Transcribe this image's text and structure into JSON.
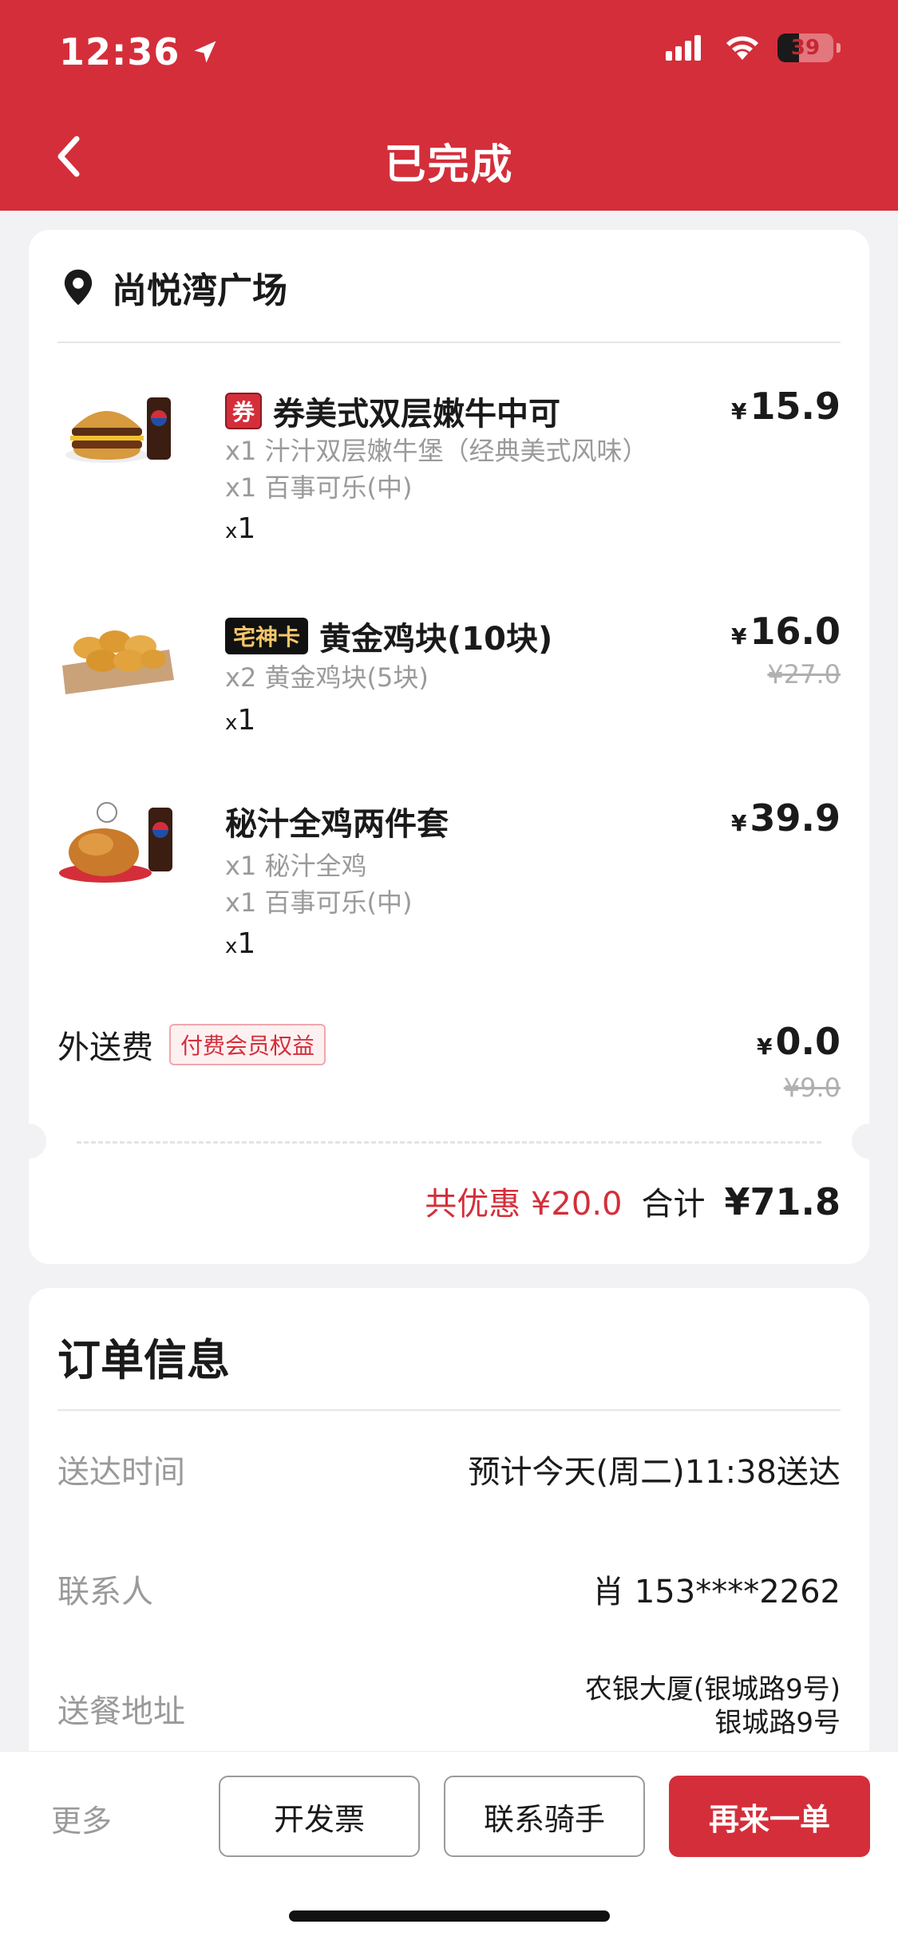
{
  "status_bar": {
    "time": "12:36",
    "battery": "39",
    "battery_level": 0.39
  },
  "header": {
    "title": "已完成"
  },
  "store": {
    "name": "尚悦湾广场"
  },
  "items": [
    {
      "badge": "券",
      "name": "券美式双层嫩牛中可",
      "subs": [
        "x1 汁汁双层嫩牛堡（经典美式风味）",
        "x1 百事可乐(中)"
      ],
      "qty_x": "x",
      "qty_n": "1",
      "currency": "¥",
      "price": "15.9",
      "image_icon": "burger-combo-icon"
    },
    {
      "badge": "宅神卡",
      "name": "黄金鸡块(10块)",
      "subs": [
        "x2 黄金鸡块(5块)"
      ],
      "qty_x": "x",
      "qty_n": "1",
      "currency": "¥",
      "price": "16.0",
      "original_price": "¥27.0",
      "image_icon": "chicken-nuggets-icon"
    },
    {
      "name": "秘汁全鸡两件套",
      "subs": [
        "x1 秘汁全鸡",
        "x1 百事可乐(中)"
      ],
      "qty_x": "x",
      "qty_n": "1",
      "currency": "¥",
      "price": "39.9",
      "image_icon": "whole-chicken-combo-icon"
    }
  ],
  "delivery_fee": {
    "label": "外送费",
    "tag": "付费会员权益",
    "currency": "¥",
    "price": "0.0",
    "original_price": "¥9.0"
  },
  "totals": {
    "discount_label": "共优惠",
    "discount_value": "¥20.0",
    "total_label": "合计",
    "total_value": "¥71.8"
  },
  "order_info": {
    "title": "订单信息",
    "rows": [
      {
        "key": "送达时间",
        "value": "预计今天(周二)11:38送达"
      },
      {
        "key": "联系人",
        "value": "肖 153****2262"
      },
      {
        "key": "送餐地址",
        "value_line1": "农银大厦(银城路9号)",
        "value_line2": "银城路9号"
      }
    ]
  },
  "bottom_bar": {
    "more": "更多",
    "invoice": "开发票",
    "contact_rider": "联系骑手",
    "reorder": "再来一单"
  },
  "colors": {
    "brand_red": "#d42e3a",
    "gold": "#f5c66b"
  }
}
